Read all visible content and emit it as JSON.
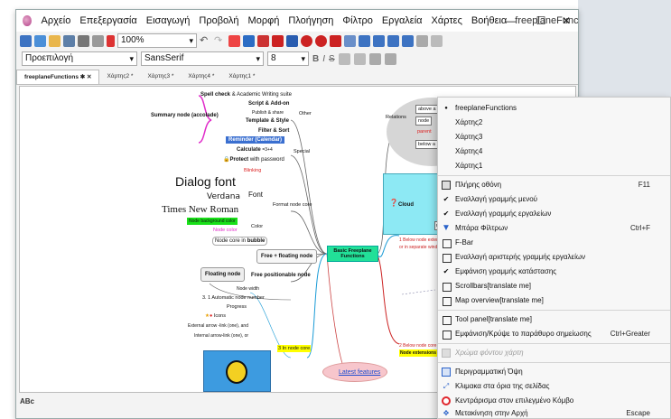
{
  "window": {
    "title": "freeplaneFunctions - Fr...",
    "menu": [
      "Αρχείο",
      "Επεξεργασία",
      "Εισαγωγή",
      "Προβολή",
      "Μορφή",
      "Πλοήγηση",
      "Φίλτρο",
      "Εργαλεία",
      "Χάρτες",
      "Βοήθεια"
    ],
    "min_glyph": "—",
    "max_glyph": "☐",
    "close_glyph": "✕"
  },
  "toolbar": {
    "zoom": "100%"
  },
  "format_bar": {
    "style": "Προεπιλογή",
    "font": "SansSerif",
    "size": "8"
  },
  "tabs": [
    "freeplaneFunctions",
    "Χάρτης2 *",
    "Χάρτης3 *",
    "Χάρτης4 *",
    "Χάρτης1 *"
  ],
  "tab_pin": "✱ ✕",
  "status": {
    "spell": "ABc"
  },
  "map": {
    "central": "Basic Freeplane Functions",
    "summary": "Summary node (accolade)",
    "spell": "Spell check",
    "spell_rest": "& Academic Writing suite",
    "script": "Script & Add-on",
    "publish": "Publish & share",
    "template": "Template & Style",
    "filter": "Filter & Sort",
    "other": "Other",
    "reminder": "Reminder (Calendar)",
    "calculate": "Calculate",
    "calc_formula": "=3+4",
    "protect": "Protect",
    "protect_rest": "with password",
    "special": "Special",
    "blinking": "Blinking",
    "dialog": "Dialog font",
    "verdana": "Verdana",
    "times": "Times New Roman",
    "font": "Font",
    "format_core": "Format node core",
    "node_bg": "Node background color",
    "node_color": "Node color",
    "color": "Color",
    "node_core_in": "Node core in",
    "bubble": "bubble",
    "free_floating": "Free + floating node",
    "floating": "Floating node",
    "free_positionable": "Free positionable node",
    "node_width": "Node width",
    "auto_number": "3. 1 Automatic node number",
    "progress": "Progress",
    "icons": "Icons",
    "external_link": "External arrow -link (one), and",
    "internal_link": "Internal arrow-link (one), or",
    "in_node_core": "3 In node core",
    "latest": "Latest features",
    "relations": "Relations",
    "above": "above a",
    "node_a": "node",
    "parent": "parent",
    "below": "below a",
    "cloud": "Cloud",
    "star": "star",
    "rect": "rectan",
    "below_ext1": "1 Below node extens",
    "below_ext1b": "or in separate window",
    "below_ext2": "2 Below node core",
    "node_ext": "Node extensions"
  },
  "dropdown": {
    "maps": [
      {
        "label": "freeplaneFunctions",
        "selected": true
      },
      {
        "label": "Χάρτης2"
      },
      {
        "label": "Χάρτης3"
      },
      {
        "label": "Χάρτης4"
      },
      {
        "label": "Χάρτης1"
      }
    ],
    "items": [
      {
        "label": "Πλήρης οθόνη",
        "shortcut": "F11",
        "icon": "fullscreen-icon",
        "kind": "icon"
      },
      {
        "label": "Εναλλαγή γραμμής μενού",
        "kind": "check",
        "checked": true
      },
      {
        "label": "Εναλλαγή γραμμής εργαλείων",
        "kind": "check",
        "checked": true
      },
      {
        "label": "Μπάρα Φίλτρων",
        "shortcut": "Ctrl+F",
        "icon": "filter-icon",
        "kind": "icon"
      },
      {
        "label": "F-Bar",
        "kind": "box"
      },
      {
        "label": "Εναλλαγή αριστερής γραμμής εργαλείων",
        "kind": "box"
      },
      {
        "label": "Εμφάνιση γραμμής κατάστασης",
        "kind": "check",
        "checked": true
      },
      {
        "label": "Scrollbars[translate me]",
        "kind": "box"
      },
      {
        "label": "Map overview[translate me]",
        "kind": "box"
      }
    ],
    "items2": [
      {
        "label": "Tool panel[translate me]",
        "kind": "box"
      },
      {
        "label": "Εμφάνιση/Κρύψε το παράθυρο σημείωσης",
        "shortcut": "Ctrl+Greater",
        "kind": "box"
      }
    ],
    "disabled": "Χρώμα φόντου χάρτη",
    "items3": [
      {
        "label": "Περιγραμματική Όψη",
        "icon": "outline-icon"
      },
      {
        "label": "Κλιμακα στα όρια της σελίδας",
        "icon": "zoom-fit-icon"
      },
      {
        "label": "Κεντράρισμα στον επιλεγμένο Κόμβο",
        "icon": "center-target-icon"
      },
      {
        "label": "Μετακίνηση στην Αρχή",
        "shortcut": "Escape",
        "icon": "move-home-icon"
      }
    ],
    "colors": {
      "accent": "#2a62c9",
      "target": "#e0262c"
    }
  }
}
